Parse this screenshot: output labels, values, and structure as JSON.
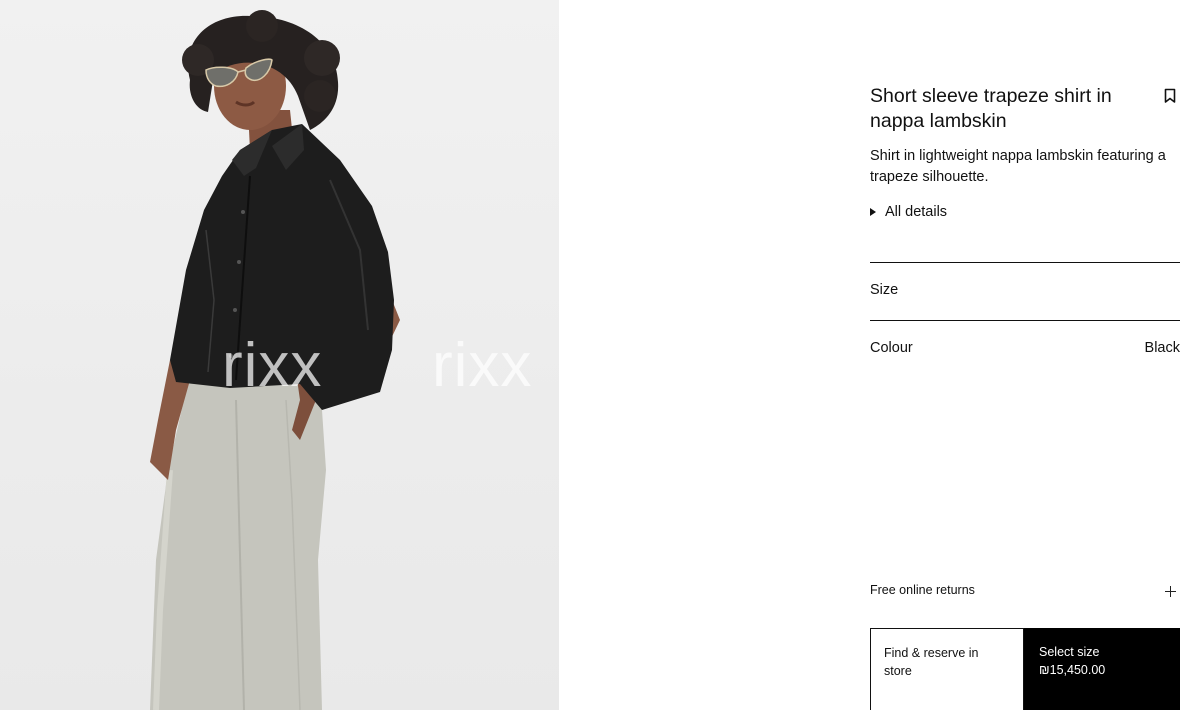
{
  "product": {
    "title": "Short sleeve trapeze shirt in nappa lambskin",
    "description": "Shirt in lightweight nappa lambskin featuring a trapeze silhouette.",
    "details_toggle": "All details",
    "size_label": "Size",
    "colour_label": "Colour",
    "colour_value": "Black"
  },
  "image": {
    "watermark": "rixx",
    "icon": "product-photo"
  },
  "returns": {
    "label": "Free online returns",
    "icon": "plus-icon"
  },
  "actions": {
    "store_label": "Find & reserve in store",
    "select_label": "Select size",
    "price": "₪15,450.00"
  },
  "colors": {
    "primary_button_bg": "#000000",
    "text": "#111111",
    "image_bg": "#eeeeee"
  }
}
